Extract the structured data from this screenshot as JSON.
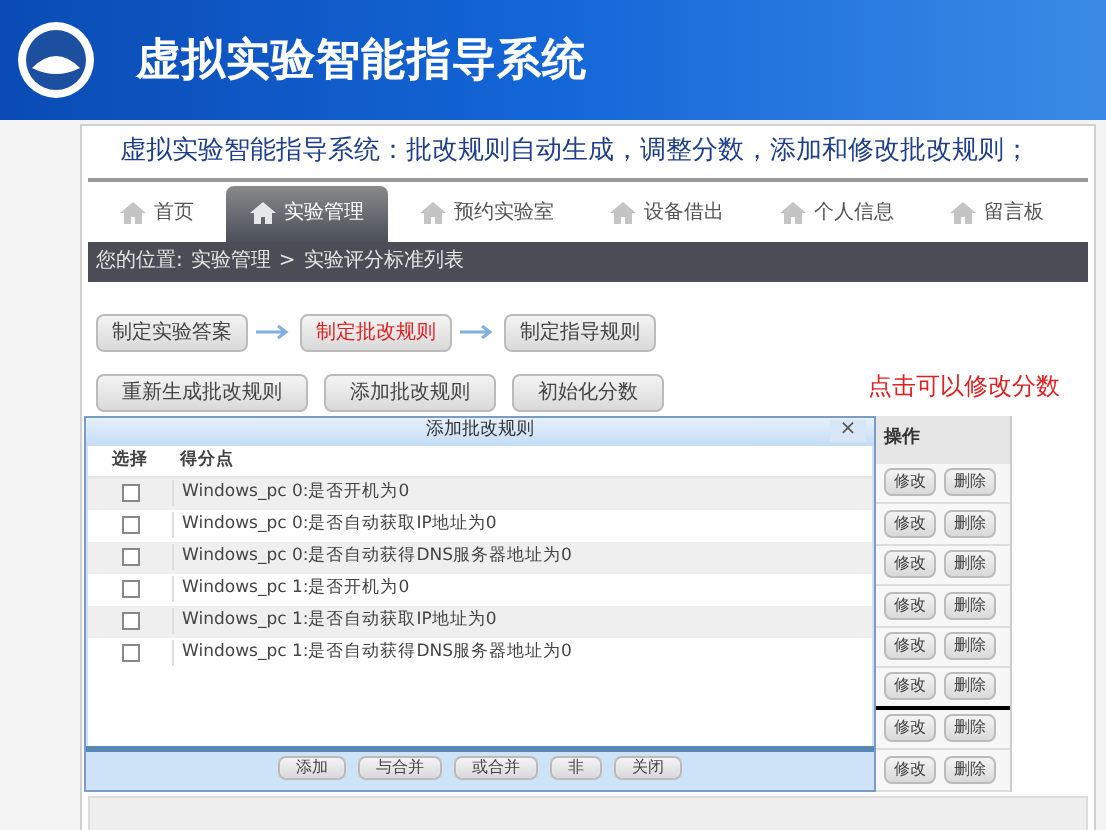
{
  "header": {
    "title": "虚拟实验智能指导系统"
  },
  "subtitle": "虚拟实验智能指导系统：批改规则自动生成，调整分数，添加和修改批改规则；",
  "nav": [
    {
      "label": "首页",
      "selected": false
    },
    {
      "label": "实验管理",
      "selected": true
    },
    {
      "label": "预约实验室",
      "selected": false
    },
    {
      "label": "设备借出",
      "selected": false
    },
    {
      "label": "个人信息",
      "selected": false
    },
    {
      "label": "留言板",
      "selected": false
    }
  ],
  "breadcrumb": {
    "prefix": "您的位置:",
    "path": [
      "实验管理",
      "实验评分标准列表"
    ],
    "separator": ">"
  },
  "steps": [
    {
      "label": "制定实验答案",
      "selected": false
    },
    {
      "label": "制定批改规则",
      "selected": true
    },
    {
      "label": "制定指导规则",
      "selected": false
    }
  ],
  "actions": [
    "重新生成批改规则",
    "添加批改规则",
    "初始化分数"
  ],
  "note": "点击可以修改分数",
  "dialog": {
    "title": "添加批改规则",
    "close": "×",
    "columns": [
      "选择",
      "得分点"
    ],
    "rows": [
      {
        "text": "Windows_pc 0:是否开机为0",
        "checked": false
      },
      {
        "text": "Windows_pc 0:是否自动获取IP地址为0",
        "checked": false
      },
      {
        "text": "Windows_pc 0:是否自动获得DNS服务器地址为0",
        "checked": false
      },
      {
        "text": "Windows_pc 1:是否开机为0",
        "checked": false
      },
      {
        "text": "Windows_pc 1:是否自动获取IP地址为0",
        "checked": false
      },
      {
        "text": "Windows_pc 1:是否自动获得DNS服务器地址为0",
        "checked": false
      }
    ],
    "buttons": [
      "添加",
      "与合并",
      "或合并",
      "非",
      "关闭"
    ]
  },
  "operations": {
    "header": "操作",
    "rows": [
      {
        "edit": "修改",
        "delete": "删除"
      },
      {
        "edit": "修改",
        "delete": "删除"
      },
      {
        "edit": "修改",
        "delete": "删除"
      },
      {
        "edit": "修改",
        "delete": "删除"
      },
      {
        "edit": "修改",
        "delete": "删除"
      },
      {
        "edit": "修改",
        "delete": "删除"
      },
      {
        "edit": "修改",
        "delete": "删除"
      },
      {
        "edit": "修改",
        "delete": "删除"
      }
    ]
  }
}
